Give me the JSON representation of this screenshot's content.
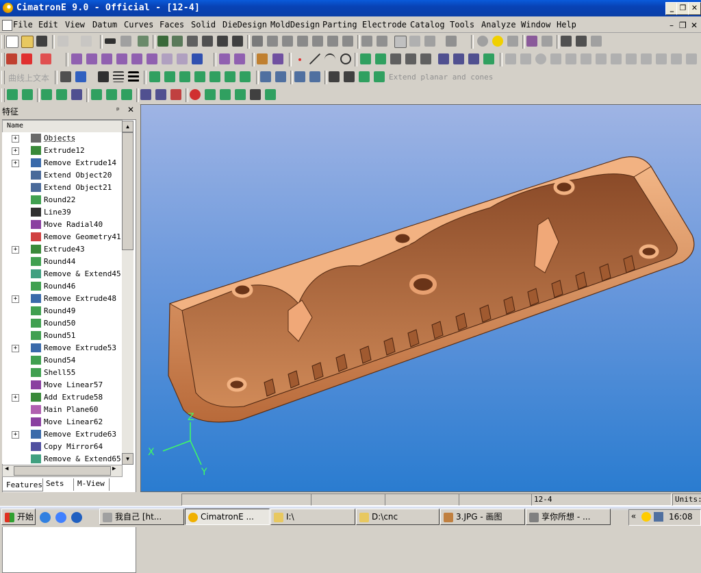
{
  "window": {
    "title": "CimatronE 9.0 - Official - [12-4]"
  },
  "menu": [
    "File",
    "Edit",
    "View",
    "Datum",
    "Curves",
    "Faces",
    "Solid",
    "DieDesign",
    "MoldDesign",
    "Parting",
    "Electrode",
    "Catalog",
    "Tools",
    "Analyze",
    "Window",
    "Help"
  ],
  "toolbar": {
    "chinese_label": "曲线上文本",
    "extend_label": "Extend planar and cones"
  },
  "panel": {
    "title": "特征",
    "column_header": "Name",
    "tabs": [
      "Features",
      "Sets",
      "M-View"
    ],
    "items": [
      {
        "label": "Objects",
        "expandable": true,
        "icon": "objects-icon"
      },
      {
        "label": "Extrude12",
        "expandable": true,
        "icon": "extrude-icon"
      },
      {
        "label": "Remove Extrude14",
        "expandable": true,
        "icon": "remove-extrude-icon"
      },
      {
        "label": "Extend Object20",
        "expandable": false,
        "icon": "extend-icon"
      },
      {
        "label": "Extend Object21",
        "expandable": false,
        "icon": "extend-icon"
      },
      {
        "label": "Round22",
        "expandable": false,
        "icon": "round-icon"
      },
      {
        "label": "Line39",
        "expandable": false,
        "icon": "line-icon"
      },
      {
        "label": "Move Radial40",
        "expandable": false,
        "icon": "move-icon"
      },
      {
        "label": "Remove Geometry41",
        "expandable": false,
        "icon": "remove-geometry-icon"
      },
      {
        "label": "Extrude43",
        "expandable": true,
        "icon": "extrude-icon"
      },
      {
        "label": "Round44",
        "expandable": false,
        "icon": "round-icon"
      },
      {
        "label": "Remove & Extend45",
        "expandable": false,
        "icon": "remove-extend-icon"
      },
      {
        "label": "Round46",
        "expandable": false,
        "icon": "round-icon"
      },
      {
        "label": "Remove Extrude48",
        "expandable": true,
        "icon": "remove-extrude-icon"
      },
      {
        "label": "Round49",
        "expandable": false,
        "icon": "round-icon"
      },
      {
        "label": "Round50",
        "expandable": false,
        "icon": "round-icon"
      },
      {
        "label": "Round51",
        "expandable": false,
        "icon": "round-icon"
      },
      {
        "label": "Remove Extrude53",
        "expandable": true,
        "icon": "remove-extrude-icon"
      },
      {
        "label": "Round54",
        "expandable": false,
        "icon": "round-icon"
      },
      {
        "label": "Shell55",
        "expandable": false,
        "icon": "shell-icon"
      },
      {
        "label": "Move Linear57",
        "expandable": false,
        "icon": "move-icon"
      },
      {
        "label": "Add Extrude58",
        "expandable": true,
        "icon": "add-extrude-icon"
      },
      {
        "label": "Main Plane60",
        "expandable": false,
        "icon": "plane-icon"
      },
      {
        "label": "Move Linear62",
        "expandable": false,
        "icon": "move-icon"
      },
      {
        "label": "Remove Extrude63",
        "expandable": true,
        "icon": "remove-extrude-icon"
      },
      {
        "label": "Copy Mirror64",
        "expandable": false,
        "icon": "mirror-icon"
      },
      {
        "label": "Remove & Extend65",
        "expandable": false,
        "icon": "remove-extend-icon"
      }
    ]
  },
  "viewport": {
    "axis_labels": {
      "x": "X",
      "y": "Y",
      "z": "Z"
    },
    "background_top": "#9fb4e4",
    "background_bottom": "#2a7cd0",
    "model_color": "#e8a070"
  },
  "statusbar": {
    "field3": "12-4",
    "units": "Units:"
  },
  "taskbar": {
    "start": "开始",
    "tasks": [
      "我自己 [ht...",
      "CimatronE ...",
      "I:\\",
      "D:\\cnc",
      "3.JPG - 画图",
      "享你所想 - ..."
    ],
    "time": "16:08"
  }
}
